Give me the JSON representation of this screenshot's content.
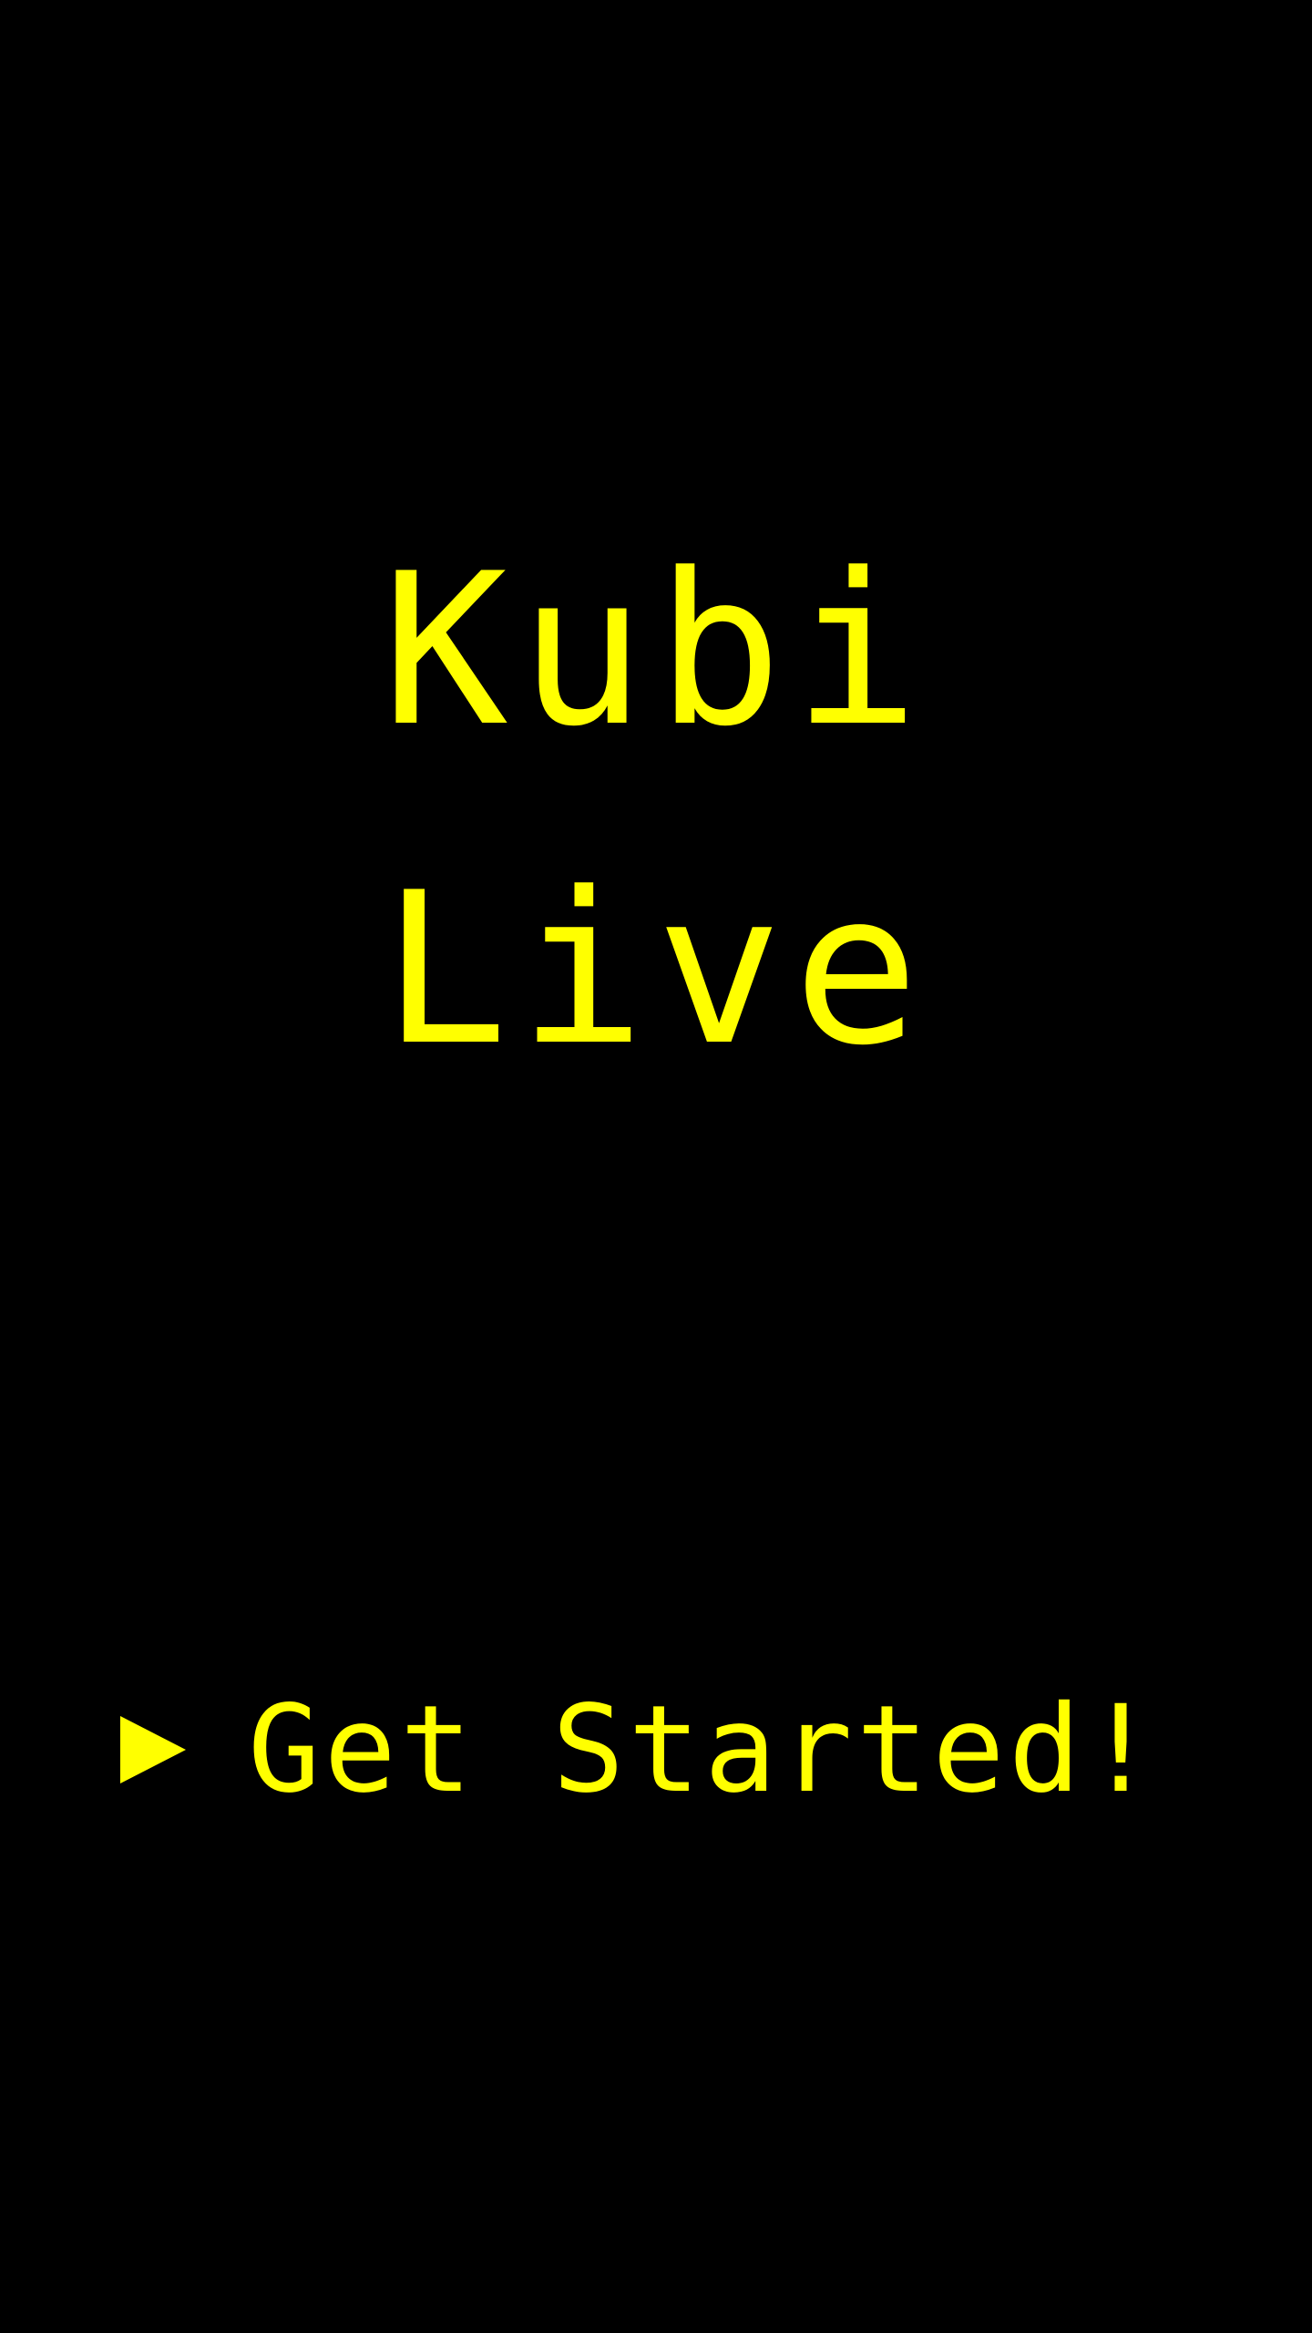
{
  "app": {
    "title_line_1": "Kubi",
    "title_line_2": "Live"
  },
  "cta": {
    "label": "Get Started!",
    "icon": "play-arrow-icon"
  },
  "colors": {
    "background": "#000000",
    "accent": "#ffff00"
  }
}
